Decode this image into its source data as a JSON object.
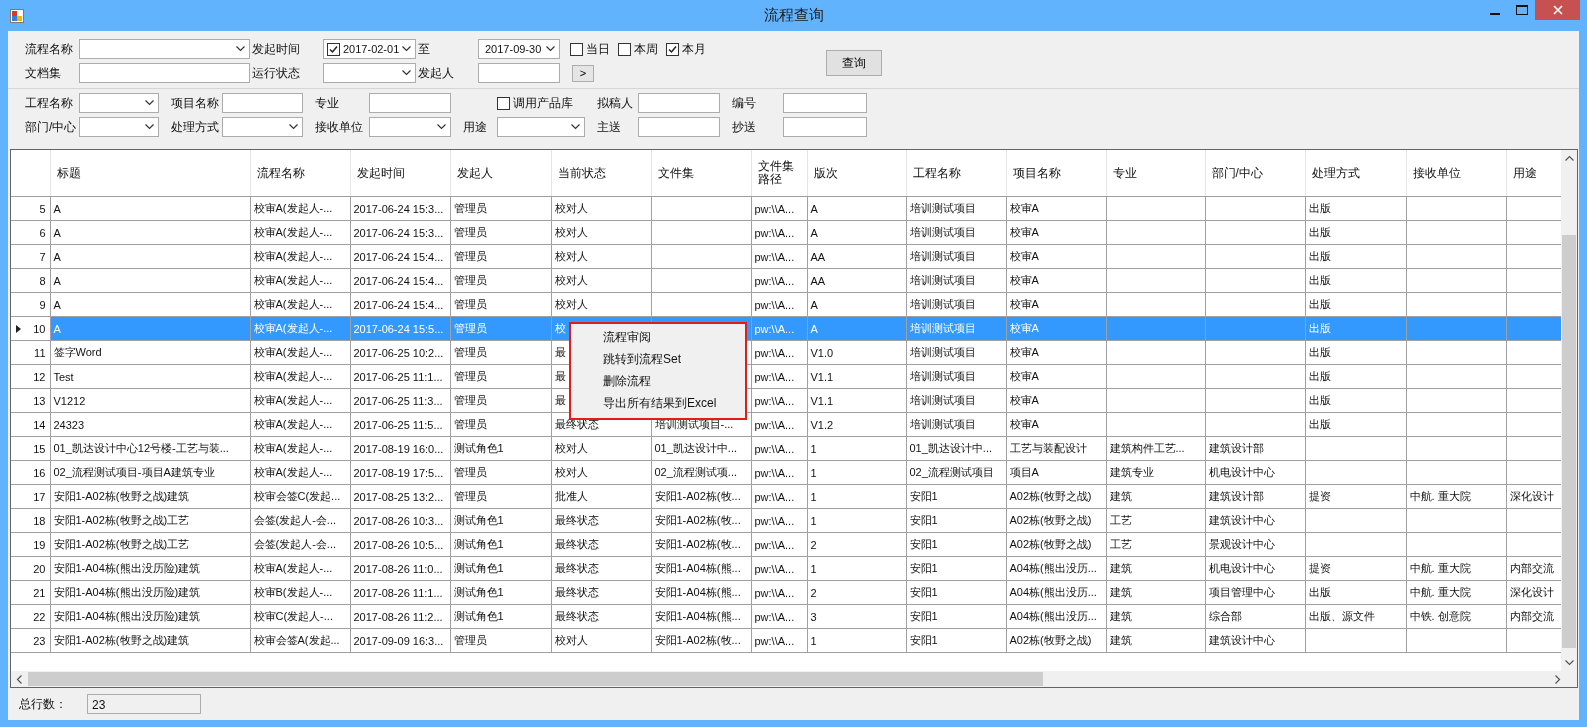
{
  "window": {
    "title": "流程查询"
  },
  "filters": {
    "top_rows": [
      [
        {
          "kind": "label",
          "text": "流程名称"
        },
        {
          "kind": "combo"
        },
        {
          "kind": "label",
          "text": "发起时间"
        },
        {
          "kind": "date",
          "value": "2017-02-01",
          "checked": true
        },
        {
          "kind": "label",
          "text": "至"
        },
        {
          "kind": "date",
          "value": "2017-09-30"
        },
        {
          "kind": "check",
          "text": "当日",
          "checked": false
        },
        {
          "kind": "check",
          "text": "本周",
          "checked": false
        },
        {
          "kind": "check",
          "text": "本月",
          "checked": true
        }
      ],
      [
        {
          "kind": "label",
          "text": "文档集"
        },
        {
          "kind": "text"
        },
        {
          "kind": "label",
          "text": "运行状态"
        },
        {
          "kind": "combo"
        },
        {
          "kind": "label",
          "text": "发起人"
        },
        {
          "kind": "text"
        },
        {
          "kind": "button",
          "text": ">"
        }
      ]
    ],
    "search_button": "查询",
    "bottom_rows": [
      [
        {
          "kind": "label",
          "text": "工程名称"
        },
        {
          "kind": "combo"
        },
        {
          "kind": "label",
          "text": "项目名称"
        },
        {
          "kind": "text"
        },
        {
          "kind": "label",
          "text": "专业"
        },
        {
          "kind": "text"
        },
        {
          "kind": "check",
          "text": "调用产品库",
          "checked": false
        },
        {
          "kind": "label",
          "text": "拟稿人"
        },
        {
          "kind": "text"
        },
        {
          "kind": "label",
          "text": "编号"
        },
        {
          "kind": "text"
        }
      ],
      [
        {
          "kind": "label",
          "text": "部门/中心"
        },
        {
          "kind": "combo"
        },
        {
          "kind": "label",
          "text": "处理方式"
        },
        {
          "kind": "combo"
        },
        {
          "kind": "label",
          "text": "接收单位"
        },
        {
          "kind": "combo"
        },
        {
          "kind": "label",
          "text": "用途"
        },
        {
          "kind": "combo"
        },
        {
          "kind": "label",
          "text": "主送"
        },
        {
          "kind": "text"
        },
        {
          "kind": "label",
          "text": "抄送"
        },
        {
          "kind": "text"
        }
      ]
    ]
  },
  "table": {
    "columns": [
      "标题",
      "流程名称",
      "发起时间",
      "发起人",
      "当前状态",
      "文件集",
      "文件集路径",
      "版次",
      "工程名称",
      "项目名称",
      "专业",
      "部门/中心",
      "处理方式",
      "接收单位",
      "用途"
    ],
    "rows": [
      {
        "number": "5",
        "selected": false,
        "cells": [
          "A",
          "校审A(发起人-...",
          "2017-06-24 15:3...",
          "管理员",
          "校对人",
          null,
          "pw:\\\\A...",
          "A",
          "培训测试项目",
          "校审A",
          null,
          null,
          "出版",
          null,
          null
        ]
      },
      {
        "number": "6",
        "selected": false,
        "cells": [
          "A",
          "校审A(发起人-...",
          "2017-06-24 15:3...",
          "管理员",
          "校对人",
          null,
          "pw:\\\\A...",
          "A",
          "培训测试项目",
          "校审A",
          null,
          null,
          "出版",
          null,
          null
        ]
      },
      {
        "number": "7",
        "selected": false,
        "cells": [
          "A",
          "校审A(发起人-...",
          "2017-06-24 15:4...",
          "管理员",
          "校对人",
          null,
          "pw:\\\\A...",
          "AA",
          "培训测试项目",
          "校审A",
          null,
          null,
          "出版",
          null,
          null
        ]
      },
      {
        "number": "8",
        "selected": false,
        "cells": [
          "A",
          "校审A(发起人-...",
          "2017-06-24 15:4...",
          "管理员",
          "校对人",
          null,
          "pw:\\\\A...",
          "AA",
          "培训测试项目",
          "校审A",
          null,
          null,
          "出版",
          null,
          null
        ]
      },
      {
        "number": "9",
        "selected": false,
        "cells": [
          "A",
          "校审A(发起人-...",
          "2017-06-24 15:4...",
          "管理员",
          "校对人",
          null,
          "pw:\\\\A...",
          "A",
          "培训测试项目",
          "校审A",
          null,
          null,
          "出版",
          null,
          null
        ]
      },
      {
        "number": "10",
        "selected": true,
        "cells": [
          "A",
          "校审A(发起人-...",
          "2017-06-24 15:5...",
          "管理员",
          "校",
          null,
          "pw:\\\\A...",
          "A",
          "培训测试项目",
          "校审A",
          null,
          null,
          "出版",
          null,
          null
        ]
      },
      {
        "number": "11",
        "selected": false,
        "cells": [
          "签字Word",
          "校审A(发起人-...",
          "2017-06-25 10:2...",
          "管理员",
          "最",
          null,
          "pw:\\\\A...",
          "V1.0",
          "培训测试项目",
          "校审A",
          null,
          null,
          "出版",
          null,
          null
        ]
      },
      {
        "number": "12",
        "selected": false,
        "cells": [
          "Test",
          "校审A(发起人-...",
          "2017-06-25 11:1...",
          "管理员",
          "最",
          null,
          "pw:\\\\A...",
          "V1.1",
          "培训测试项目",
          "校审A",
          null,
          null,
          "出版",
          null,
          null
        ]
      },
      {
        "number": "13",
        "selected": false,
        "cells": [
          "V1212",
          "校审A(发起人-...",
          "2017-06-25 11:3...",
          "管理员",
          "最",
          null,
          "pw:\\\\A...",
          "V1.1",
          "培训测试项目",
          "校审A",
          null,
          null,
          "出版",
          null,
          null
        ]
      },
      {
        "number": "14",
        "selected": false,
        "cells": [
          "24323",
          "校审A(发起人-...",
          "2017-06-25 11:5...",
          "管理员",
          "最终状态",
          "培训测试项目-...",
          "pw:\\\\A...",
          "V1.2",
          "培训测试项目",
          "校审A",
          null,
          null,
          "出版",
          null,
          null
        ]
      },
      {
        "number": "15",
        "selected": false,
        "cells": [
          "01_凯达设计中心12号楼-工艺与装...",
          "校审A(发起人-...",
          "2017-08-19 16:0...",
          "测试角色1",
          "校对人",
          "01_凯达设计中...",
          "pw:\\\\A...",
          "1",
          "01_凯达设计中...",
          "工艺与装配设计",
          "建筑构件工艺...",
          "建筑设计部",
          null,
          null,
          null
        ]
      },
      {
        "number": "16",
        "selected": false,
        "cells": [
          "02_流程测试项目-项目A建筑专业",
          "校审A(发起人-...",
          "2017-08-19 17:5...",
          "管理员",
          "校对人",
          "02_流程测试项...",
          "pw:\\\\A...",
          "1",
          "02_流程测试项目",
          "项目A",
          "建筑专业",
          "机电设计中心",
          null,
          null,
          null
        ]
      },
      {
        "number": "17",
        "selected": false,
        "cells": [
          "安阳1-A02栋(牧野之战)建筑",
          "校审会签C(发起...",
          "2017-08-25 13:2...",
          "管理员",
          "批准人",
          "安阳1-A02栋(牧...",
          "pw:\\\\A...",
          "1",
          "安阳1",
          "A02栋(牧野之战)",
          "建筑",
          "建筑设计部",
          "提资",
          "中航. 重大院",
          "深化设计"
        ]
      },
      {
        "number": "18",
        "selected": false,
        "cells": [
          "安阳1-A02栋(牧野之战)工艺",
          "会签(发起人-会...",
          "2017-08-26 10:3...",
          "测试角色1",
          "最终状态",
          "安阳1-A02栋(牧...",
          "pw:\\\\A...",
          "1",
          "安阳1",
          "A02栋(牧野之战)",
          "工艺",
          "建筑设计中心",
          null,
          null,
          null
        ]
      },
      {
        "number": "19",
        "selected": false,
        "cells": [
          "安阳1-A02栋(牧野之战)工艺",
          "会签(发起人-会...",
          "2017-08-26 10:5...",
          "测试角色1",
          "最终状态",
          "安阳1-A02栋(牧...",
          "pw:\\\\A...",
          "2",
          "安阳1",
          "A02栋(牧野之战)",
          "工艺",
          "景观设计中心",
          null,
          null,
          null
        ]
      },
      {
        "number": "20",
        "selected": false,
        "cells": [
          "安阳1-A04栋(熊出没历险)建筑",
          "校审A(发起人-...",
          "2017-08-26 11:0...",
          "测试角色1",
          "最终状态",
          "安阳1-A04栋(熊...",
          "pw:\\\\A...",
          "1",
          "安阳1",
          "A04栋(熊出没历...",
          "建筑",
          "机电设计中心",
          "提资",
          "中航. 重大院",
          "内部交流"
        ]
      },
      {
        "number": "21",
        "selected": false,
        "cells": [
          "安阳1-A04栋(熊出没历险)建筑",
          "校审B(发起人-...",
          "2017-08-26 11:1...",
          "测试角色1",
          "最终状态",
          "安阳1-A04栋(熊...",
          "pw:\\\\A...",
          "2",
          "安阳1",
          "A04栋(熊出没历...",
          "建筑",
          "项目管理中心",
          "出版",
          "中航. 重大院",
          "深化设计"
        ]
      },
      {
        "number": "22",
        "selected": false,
        "cells": [
          "安阳1-A04栋(熊出没历险)建筑",
          "校审C(发起人-...",
          "2017-08-26 11:2...",
          "测试角色1",
          "最终状态",
          "安阳1-A04栋(熊...",
          "pw:\\\\A...",
          "3",
          "安阳1",
          "A04栋(熊出没历...",
          "建筑",
          "综合部",
          "出版、源文件",
          "中铁. 创意院",
          "内部交流"
        ]
      },
      {
        "number": "23",
        "selected": false,
        "cells": [
          "安阳1-A02栋(牧野之战)建筑",
          "校审会签A(发起...",
          "2017-09-09 16:3...",
          "管理员",
          "校对人",
          "安阳1-A02栋(牧...",
          "pw:\\\\A...",
          "1",
          "安阳1",
          "A02栋(牧野之战)",
          "建筑",
          "建筑设计中心",
          null,
          null,
          null
        ]
      }
    ]
  },
  "context_menu": {
    "items": [
      "流程审阅",
      "跳转到流程Set",
      "删除流程",
      "导出所有结果到Excel"
    ]
  },
  "status_bar": {
    "label": "总行数：",
    "value": "23"
  }
}
